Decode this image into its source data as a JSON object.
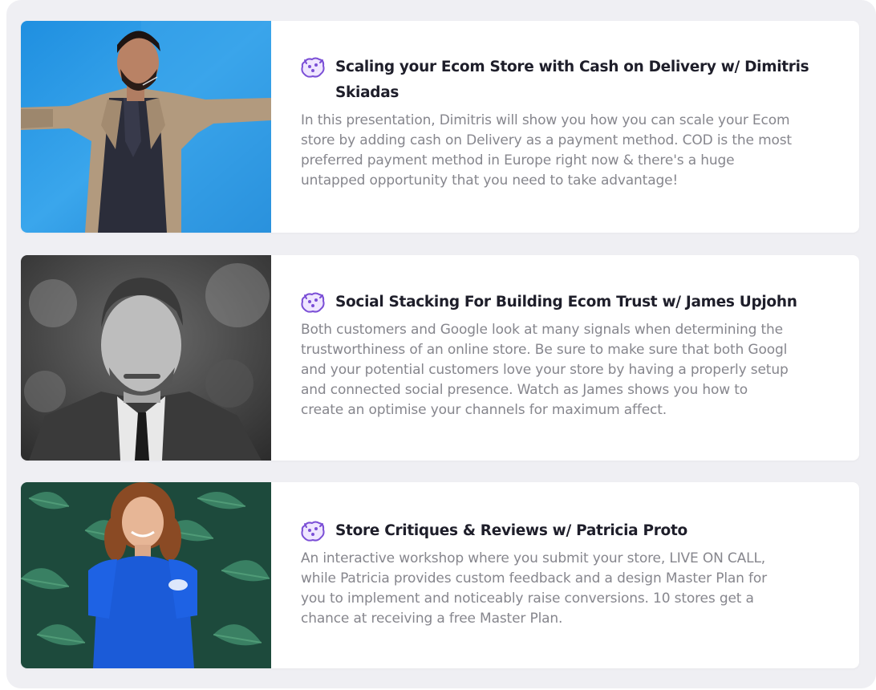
{
  "sessions": [
    {
      "title": "Scaling your Ecom Store with Cash on Delivery w/ Dimitris Skiadas",
      "description_lines": [
        "In this presentation, Dimitris will show you how you can scale your Ecom",
        "store by adding cash on Delivery as a payment method. COD is the most",
        "preferred payment method in Europe right now & there's a huge",
        "untapped opportunity that you need to take advantage!"
      ],
      "icon": "brain-icon"
    },
    {
      "title": "Social Stacking For Building Ecom Trust w/ James Upjohn",
      "description_lines": [
        "Both customers and Google look at many signals when determining the",
        "trustworthiness of an online store. Be sure to make sure that both Googl",
        "and your potential customers love your store by having a properly setup",
        "and connected social presence. Watch as James shows you how to",
        "create an optimise your channels for maximum affect."
      ],
      "icon": "brain-icon"
    },
    {
      "title": "Store Critiques & Reviews w/ Patricia Proto",
      "description_lines": [
        "An interactive workshop where you submit your store, LIVE ON CALL,",
        "while Patricia provides custom feedback and a design Master Plan for",
        "you to implement and noticeably raise conversions. 10 stores get a",
        "chance at receiving a free Master Plan."
      ],
      "icon": "brain-icon"
    }
  ],
  "colors": {
    "background": "#efeff3",
    "card": "#ffffff",
    "title": "#1e1e2a",
    "description": "#86868d",
    "icon_accent": "#7b4fd6"
  }
}
